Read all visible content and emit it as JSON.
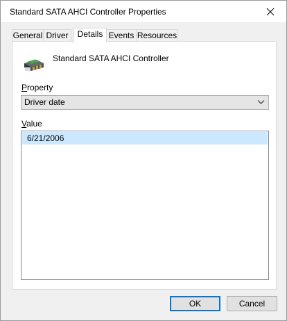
{
  "window": {
    "title": "Standard SATA AHCI Controller Properties",
    "close_icon": "close-icon"
  },
  "tabs": [
    {
      "label": "General",
      "active": false
    },
    {
      "label": "Driver",
      "active": false
    },
    {
      "label": "Details",
      "active": true
    },
    {
      "label": "Events",
      "active": false
    },
    {
      "label": "Resources",
      "active": false
    }
  ],
  "details": {
    "device_icon": "storage-controller-icon",
    "device_name": "Standard SATA AHCI Controller",
    "property_label_mnemonic": "P",
    "property_label_rest": "roperty",
    "property_selected": "Driver date",
    "value_label_mnemonic": "V",
    "value_label_rest": "alue",
    "values": [
      "6/21/2006"
    ]
  },
  "buttons": {
    "ok": "OK",
    "cancel": "Cancel"
  },
  "colors": {
    "selection": "#cce8ff",
    "accent": "#0078d7"
  }
}
